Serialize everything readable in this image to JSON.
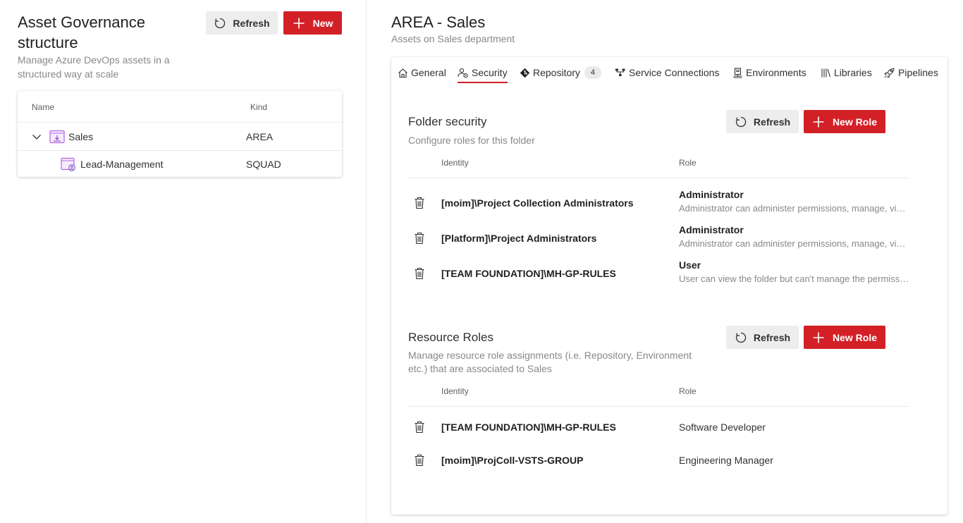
{
  "left": {
    "title": "Asset Governance structure",
    "subtitle": "Manage Azure DevOps assets in a structured way at scale",
    "refresh_label": "Refresh",
    "new_label": "New",
    "tree": {
      "columns": {
        "name": "Name",
        "kind": "Kind"
      },
      "rows": [
        {
          "label": "Sales",
          "kind": "AREA",
          "icon": "area-folder-icon",
          "expanded": true
        },
        {
          "label": "Lead-Management",
          "kind": "SQUAD",
          "icon": "squad-folder-icon"
        }
      ]
    }
  },
  "right": {
    "title": "AREA - Sales",
    "subtitle": "Assets on Sales department",
    "tabs": [
      {
        "label": "General",
        "icon": "home-icon"
      },
      {
        "label": "Security",
        "icon": "people-icon",
        "active": true
      },
      {
        "label": "Repository",
        "icon": "git-icon",
        "count": "4"
      },
      {
        "label": "Service Connections",
        "icon": "plug-icon"
      },
      {
        "label": "Environments",
        "icon": "server-icon"
      },
      {
        "label": "Libraries",
        "icon": "library-icon"
      },
      {
        "label": "Pipelines",
        "icon": "rocket-icon"
      }
    ],
    "folder_security": {
      "title": "Folder security",
      "description": "Configure roles for this folder",
      "refresh_label": "Refresh",
      "new_role_label": "New Role",
      "columns": {
        "identity": "Identity",
        "role": "Role"
      },
      "rows": [
        {
          "identity": "[moim]\\Project Collection Administrators",
          "role": "Administrator",
          "role_description": "Administrator can administer permissions, manage, view and use pipelines."
        },
        {
          "identity": "[Platform]\\Project Administrators",
          "role": "Administrator",
          "role_description": "Administrator can administer permissions, manage, view and use pipelines."
        },
        {
          "identity": "[TEAM FOUNDATION]\\MH-GP-RULES",
          "role": "User",
          "role_description": "User can view the folder but can't manage the permissions."
        }
      ]
    },
    "resource_roles": {
      "title": "Resource Roles",
      "description": "Manage resource role assignments (i.e. Repository, Environment etc.) that are associated to Sales",
      "refresh_label": "Refresh",
      "new_role_label": "New Role",
      "columns": {
        "identity": "Identity",
        "role": "Role"
      },
      "rows": [
        {
          "identity": "[TEAM FOUNDATION]\\MH-GP-RULES",
          "role": "Software Developer"
        },
        {
          "identity": "[moim]\\ProjColl-VSTS-GROUP",
          "role": "Engineering Manager"
        }
      ]
    }
  },
  "colors": {
    "accent": "#d32027",
    "secondary_button": "#ededed",
    "muted_text": "#8a8886",
    "area_icon": "#b366e6"
  }
}
